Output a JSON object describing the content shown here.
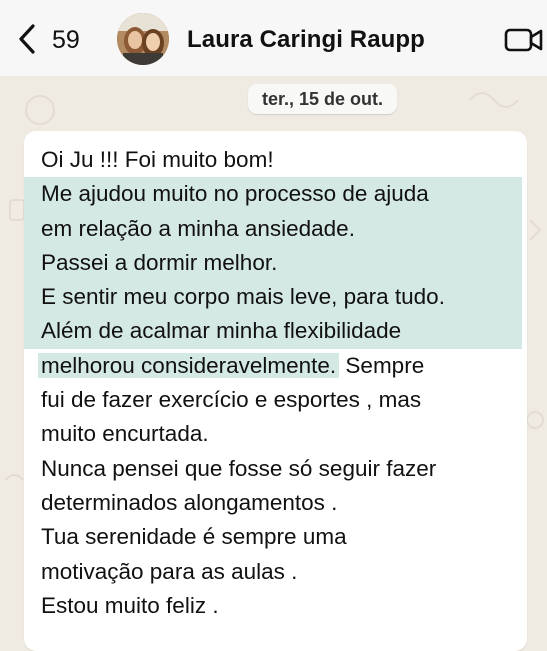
{
  "header": {
    "unread_count": "59",
    "contact_name": "Laura Caringi Raupp"
  },
  "date_separator": "ter., 15 de out.",
  "message": {
    "lines": [
      "Oi Ju !!! Foi muito bom!",
      "Me ajudou muito no processo de ajuda",
      "em relação a minha ansiedade.",
      "Passei a dormir melhor.",
      "E sentir meu corpo mais leve, para tudo.",
      "Além de acalmar minha flexibilidade",
      "melhorou consideravelmente.",
      " Sempre",
      "fui de fazer exercício e esportes , mas",
      "muito encurtada.",
      "Nunca pensei que fosse só seguir fazer",
      "determinados alongamentos .",
      "Tua serenidade é sempre uma",
      "motivação para as aulas .",
      "Estou muito feliz ."
    ]
  },
  "colors": {
    "background": "#efeae2",
    "header": "#f7f7f7",
    "bubble": "#ffffff",
    "highlight": "#d4e8e4"
  }
}
